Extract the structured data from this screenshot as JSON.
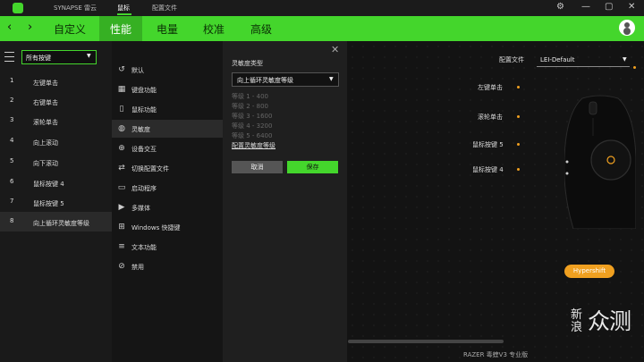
{
  "titlebar": {
    "app": "SYNAPSE 雷云",
    "tab_mouse": "鼠标",
    "tab_profile": "配置文件",
    "win_gear": "⚙",
    "win_min": "—",
    "win_max": "▢",
    "win_close": "✕"
  },
  "nav": {
    "back": "‹",
    "forward": "›",
    "tabs": [
      "自定义",
      "性能",
      "电量",
      "校准",
      "高级"
    ],
    "selected": "性能"
  },
  "left": {
    "dropdown_value": "所有按键",
    "buttons": [
      {
        "num": "1",
        "small": "",
        "label": "左键单击"
      },
      {
        "num": "2",
        "small": "",
        "label": "右键单击"
      },
      {
        "num": "3",
        "small": "",
        "label": "滚轮单击"
      },
      {
        "num": "4",
        "small": "",
        "label": "向上滚动"
      },
      {
        "num": "5",
        "small": "",
        "label": "向下滚动"
      },
      {
        "num": "6",
        "small": "",
        "label": "鼠标按键 4"
      },
      {
        "num": "7",
        "small": "",
        "label": "鼠标按键 5"
      },
      {
        "num": "8",
        "small": "",
        "label": "向上循环灵敏度等级"
      }
    ]
  },
  "functions": [
    {
      "icon": "↺",
      "icon_name": "default-icon",
      "label": "默认"
    },
    {
      "icon": "▦",
      "icon_name": "keyboard-icon",
      "label": "键盘功能"
    },
    {
      "icon": "▯",
      "icon_name": "mouse-icon",
      "label": "鼠标功能"
    },
    {
      "icon": "◍",
      "icon_name": "sensitivity-icon",
      "label": "灵敏度"
    },
    {
      "icon": "⊕",
      "icon_name": "interdevice-icon",
      "label": "设备交互"
    },
    {
      "icon": "⇄",
      "icon_name": "switch-profile-icon",
      "label": "切换配置文件"
    },
    {
      "icon": "▭",
      "icon_name": "launch-program-icon",
      "label": "启动程序"
    },
    {
      "icon": "▶",
      "icon_name": "multimedia-icon",
      "label": "多媒体"
    },
    {
      "icon": "⊞",
      "icon_name": "windows-shortcut-icon",
      "label": "Windows 快捷键"
    },
    {
      "icon": "≡",
      "icon_name": "text-function-icon",
      "label": "文本功能"
    },
    {
      "icon": "⊘",
      "icon_name": "disable-icon",
      "label": "禁用"
    }
  ],
  "detail": {
    "close": "✕",
    "heading": "灵敏度类型",
    "dropdown_value": "向上循环灵敏度等级",
    "levels": [
      "等级 1 - 400",
      "等级 2 - 800",
      "等级 3 - 1600",
      "等级 4 - 3200",
      "等级 5 - 6400"
    ],
    "link": "配置灵敏度等级",
    "cancel": "取消",
    "save": "保存"
  },
  "canvas": {
    "profile_label": "配置文件",
    "profile_value": "LEI-Default",
    "callouts": [
      "左键单击",
      "滚轮单击",
      "鼠标按键 5",
      "鼠标按键 4"
    ],
    "hypershift": "Hypershift",
    "device_name": "RAZER 毒蝰V3 专业版",
    "watermark": "新浪众测"
  },
  "colors": {
    "accent": "#44d62c",
    "hypershift": "#f0a020"
  }
}
